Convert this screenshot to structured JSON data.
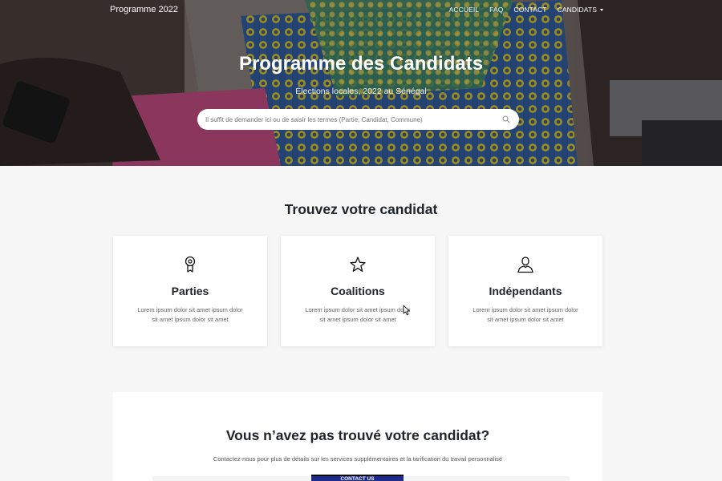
{
  "nav": {
    "brand": "Programme 2022",
    "links": [
      "ACCUEIL",
      "FAQ",
      "CONTACT",
      "CANDIDATS"
    ],
    "dropdown_icon": "caret-down-icon"
  },
  "hero": {
    "title": "Programme des Candidats",
    "subtitle": "Élections locales, 2022 au Sénégal",
    "search_placeholder": "Il suffit de demander ici ou de saisir les termes (Partie, Candidat, Commune)",
    "search_value": "",
    "search_icon": "search-icon"
  },
  "finder": {
    "title": "Trouvez votre candidat",
    "cards": [
      {
        "icon": "award-medal-icon",
        "title": "Parties",
        "text": "Lorem ipsum dolor sit amet ipsum dolor sit amet ipsum dolor sit amet"
      },
      {
        "icon": "star-icon",
        "title": "Coalitions",
        "text": "Lorem ipsum dolor sit amet ipsum dolor sit amet ipsum dolor sit amet"
      },
      {
        "icon": "user-icon",
        "title": "Indépendants",
        "text": "Lorem ipsum dolor sit amet ipsum dolor sit amet ipsum dolor sit amet"
      }
    ]
  },
  "contact": {
    "title": "Vous n’avez pas trouvé votre candidat?",
    "text": "Contactez-nous pour plus de détails sur les services supplémentaires et la tarification du travail personnalisé",
    "button": "CONTACT US"
  },
  "colors": {
    "button_bg": "#1d2b8c",
    "heading": "#212529",
    "page_bg": "#f7f7f7"
  }
}
